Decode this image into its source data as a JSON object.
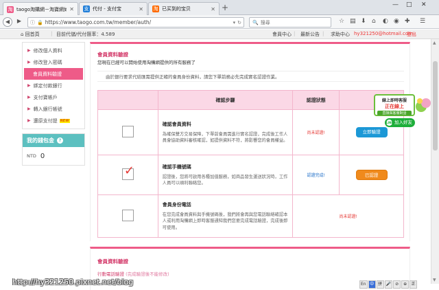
{
  "browser": {
    "tabs": [
      {
        "label": "taogo淘購網－淘寶網如何購",
        "favicon": "淘",
        "color": "#ee5b88"
      },
      {
        "label": "代付 - 支付宝",
        "favicon": "支",
        "color": "#1e7dd8"
      },
      {
        "label": "已买到的宝贝",
        "favicon": "淘",
        "color": "#ff6a00"
      }
    ],
    "new_tab": "+",
    "url": "https://www.taogo.com.tw/member/auth/",
    "search_placeholder": "搜尋",
    "window_controls": [
      "—",
      "□",
      "✕"
    ]
  },
  "site_header": {
    "home": "回首頁",
    "agent_rate": "目前代儲/代付匯率：4.589",
    "member_center": "會員中心",
    "news": "最新公告",
    "help": "求助中心",
    "email": "hy321250@hotmail.com",
    "logout": "登出"
  },
  "sidebar": {
    "items": [
      {
        "label": "修改個人資料"
      },
      {
        "label": "修改登入密碼"
      },
      {
        "label": "會員資料驗證",
        "active": true
      },
      {
        "label": "綁定付款銀行"
      },
      {
        "label": "支付寶帳戶"
      },
      {
        "label": "轉入銀行帳號"
      },
      {
        "label": "還原支付提",
        "badge": "NEW"
      }
    ],
    "wallet": {
      "title": "我的錢包金",
      "help_icon": "?",
      "currency": "NTD",
      "amount": "0"
    }
  },
  "verification": {
    "title": "會員資料驗證",
    "subtitle": "您現在已經可以開始使用淘購網提供的所有服務了",
    "note": "由於銀行要求代結匯需提供正確的會員身份資料，請您下單前務必先完成實名認證作業。",
    "headers": [
      "",
      "確認步驟",
      "認證狀態",
      ""
    ],
    "steps": [
      {
        "title": "確認會員資料",
        "desc": "為確保雙方交易保障，下單前會員需進行實名認證，完成後工作人員會協助資料審核確認，如提供資料不符，將影響您的會員權益。",
        "checked": false,
        "status": "尚未認證!",
        "status_color": "red",
        "action": "立即驗證",
        "action_color": "blue"
      },
      {
        "title": "確認手機號碼",
        "desc": "認證後，您將可啟用各種加值服務，如商品發生運送狀況時，工作人員可以順利聯絡您。",
        "checked": true,
        "status": "認證完成!",
        "status_color": "blue",
        "action": "已認證",
        "action_color": "orange"
      },
      {
        "title": "會員身份電話",
        "desc": "在您完成會員資料與手機號碼後，我們將會再與您電話聯絡確認本人或利用淘購網上即時客服通知我們您要完成電話驗證，完成後即可使用。",
        "checked": false,
        "status": "尚未認證!",
        "status_color": "red",
        "action": "",
        "action_color": ""
      }
    ]
  },
  "chat_widget": {
    "line1": "線上即時客服",
    "line2": "正在線上",
    "line3": "直接與客服對話",
    "add_friend": "加入好友",
    "line_logo": "LINE"
  },
  "panel2": {
    "title": "會員資料驗證",
    "phone_label": "行動電話驗證",
    "phone_note": "(完成驗證後不能修改)"
  },
  "watermark": "http://hy321250.pixnet.net/blog",
  "ime": [
    "En",
    "中",
    "拼",
    "🎤",
    "⊘",
    "⊕",
    "正"
  ],
  "colors": {
    "accent_pink": "#ee5b88",
    "header_pink": "#fbd8e6",
    "teal": "#5cc0c0",
    "orange": "#f08a1c",
    "blue": "#1c98d6"
  }
}
